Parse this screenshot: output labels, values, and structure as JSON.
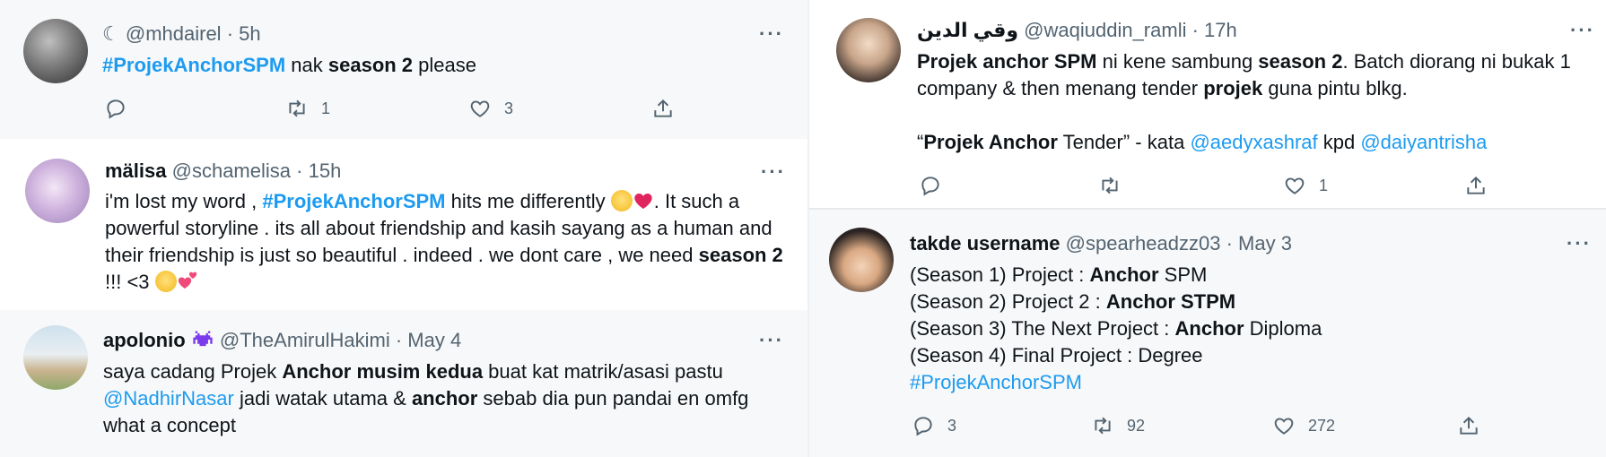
{
  "tweets": [
    {
      "name": "",
      "icon_name": "crescent-moon-icon",
      "name_glyph": "☾",
      "handle": "@mhdairel",
      "time": "5h",
      "segments": [
        {
          "t": "#ProjekAnchorSPM",
          "s": "tag"
        },
        {
          "t": " nak ",
          "s": ""
        },
        {
          "t": "season 2",
          "s": "b"
        },
        {
          "t": " please",
          "s": ""
        }
      ],
      "reply": "",
      "retweet": "1",
      "like": "3"
    },
    {
      "name": "mälisa",
      "handle": "@schamelisa",
      "time": "15h",
      "segments": [
        {
          "t": "i'm lost my word , ",
          "s": ""
        },
        {
          "t": "#ProjekAnchorSPM",
          "s": "tag"
        },
        {
          "t": " hits me differently ",
          "s": ""
        },
        {
          "t": "face-holding-back-tears",
          "s": "emoji-face"
        },
        {
          "t": "red-heart",
          "s": "emoji-heart"
        },
        {
          "t": ". It such a powerful storyline . its all about friendship and kasih sayang as a human and their friendship is just so beautiful . indeed . we dont care , we need ",
          "s": ""
        },
        {
          "t": "season 2",
          "s": "b"
        },
        {
          "t": " !!! <3 ",
          "s": ""
        },
        {
          "t": "loudly-crying-face",
          "s": "emoji-cry"
        },
        {
          "t": "two-hearts",
          "s": "emoji-hearts2"
        }
      ],
      "reply": "",
      "retweet": "",
      "like": ""
    },
    {
      "name": "apolonio",
      "icon_name": "space-invader-icon",
      "handle": "@TheAmirulHakimi",
      "time": "May 4",
      "segments": [
        {
          "t": "saya cadang Projek ",
          "s": ""
        },
        {
          "t": "Anchor musim kedua",
          "s": "b"
        },
        {
          "t": " buat kat matrik/asasi pastu ",
          "s": ""
        },
        {
          "t": "@NadhirNasar",
          "s": "mention"
        },
        {
          "t": " jadi watak utama & ",
          "s": ""
        },
        {
          "t": "anchor",
          "s": "b"
        },
        {
          "t": " sebab dia pun pandai en omfg what a concept",
          "s": ""
        }
      ]
    },
    {
      "name": "وقي الدين",
      "handle": "@waqiuddin_ramli",
      "time": "17h",
      "segments": [
        {
          "t": "Projek anchor SPM",
          "s": "b"
        },
        {
          "t": " ni kene sambung ",
          "s": ""
        },
        {
          "t": "season 2",
          "s": "b"
        },
        {
          "t": ". Batch diorang ni bukak 1 company & then menang tender ",
          "s": ""
        },
        {
          "t": "projek",
          "s": "b"
        },
        {
          "t": " guna pintu blkg.",
          "s": ""
        },
        {
          "t": "",
          "s": "br2"
        },
        {
          "t": "“",
          "s": ""
        },
        {
          "t": "Projek Anchor",
          "s": "b"
        },
        {
          "t": " Tender” - kata ",
          "s": ""
        },
        {
          "t": "@aedyxashraf",
          "s": "mention"
        },
        {
          "t": " kpd ",
          "s": ""
        },
        {
          "t": "@daiyantrisha",
          "s": "mention"
        }
      ],
      "reply": "",
      "retweet": "",
      "like": "1"
    },
    {
      "name": "takde username",
      "handle": "@spearheadzz03",
      "time": "May 3",
      "segments": [
        {
          "t": "(Season 1) Project : ",
          "s": ""
        },
        {
          "t": "Anchor",
          "s": "b"
        },
        {
          "t": " SPM",
          "s": ""
        },
        {
          "t": "",
          "s": "br"
        },
        {
          "t": "(Season 2) Project 2 : ",
          "s": ""
        },
        {
          "t": "Anchor STPM",
          "s": "b"
        },
        {
          "t": "",
          "s": "br"
        },
        {
          "t": "(Season 3) The Next Project : ",
          "s": ""
        },
        {
          "t": "Anchor",
          "s": "b"
        },
        {
          "t": " Diploma",
          "s": ""
        },
        {
          "t": "",
          "s": "br"
        },
        {
          "t": "(Season 4) Final Project : Degree",
          "s": ""
        },
        {
          "t": "",
          "s": "br"
        },
        {
          "t": "#ProjekAnchorSPM",
          "s": "tagplain"
        }
      ],
      "reply": "3",
      "retweet": "92",
      "like": "272"
    }
  ],
  "colors": {
    "accent": "#1d9bf0",
    "text": "#0f1419",
    "muted": "#536471",
    "divider": "#e6e9ec",
    "gap": "#f4f5f6"
  }
}
